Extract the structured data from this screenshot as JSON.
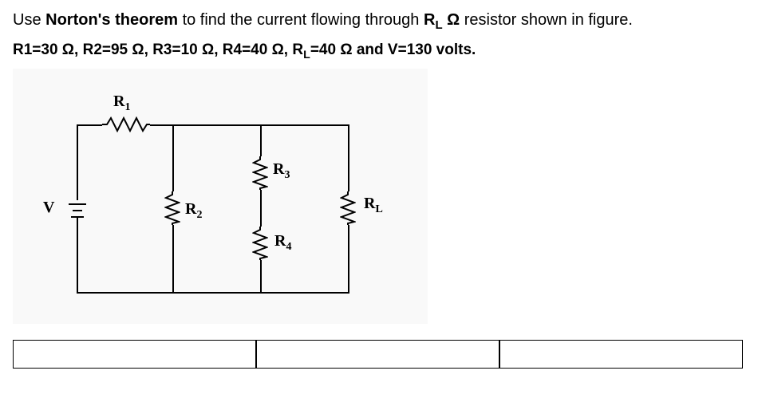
{
  "problem": {
    "prefix": "Use ",
    "theorem_bold": "Norton's theorem",
    "middle": " to find the current flowing through ",
    "rl_bold_pre": "R",
    "rl_bold_sub": "L",
    "rl_bold_post": " Ω",
    "suffix": " resistor shown in figure."
  },
  "values": {
    "r1": "R1=30 Ω,  ",
    "r2": "R2=95 Ω, ",
    "r3": "R3=10 Ω, ",
    "r4": "R4=40 Ω,  ",
    "rl_pre": "R",
    "rl_sub": "L",
    "rl_post": "=40 Ω ",
    "and": "and ",
    "v": "V=130 volts."
  },
  "labels": {
    "r1": "R",
    "r1_sub": "1",
    "r2": "R",
    "r2_sub": "2",
    "r3": "R",
    "r3_sub": "3",
    "r4": "R",
    "r4_sub": "4",
    "rl": "R",
    "rl_sub": "L",
    "v": "V"
  },
  "answers": {
    "a": "",
    "b": "",
    "c": ""
  }
}
